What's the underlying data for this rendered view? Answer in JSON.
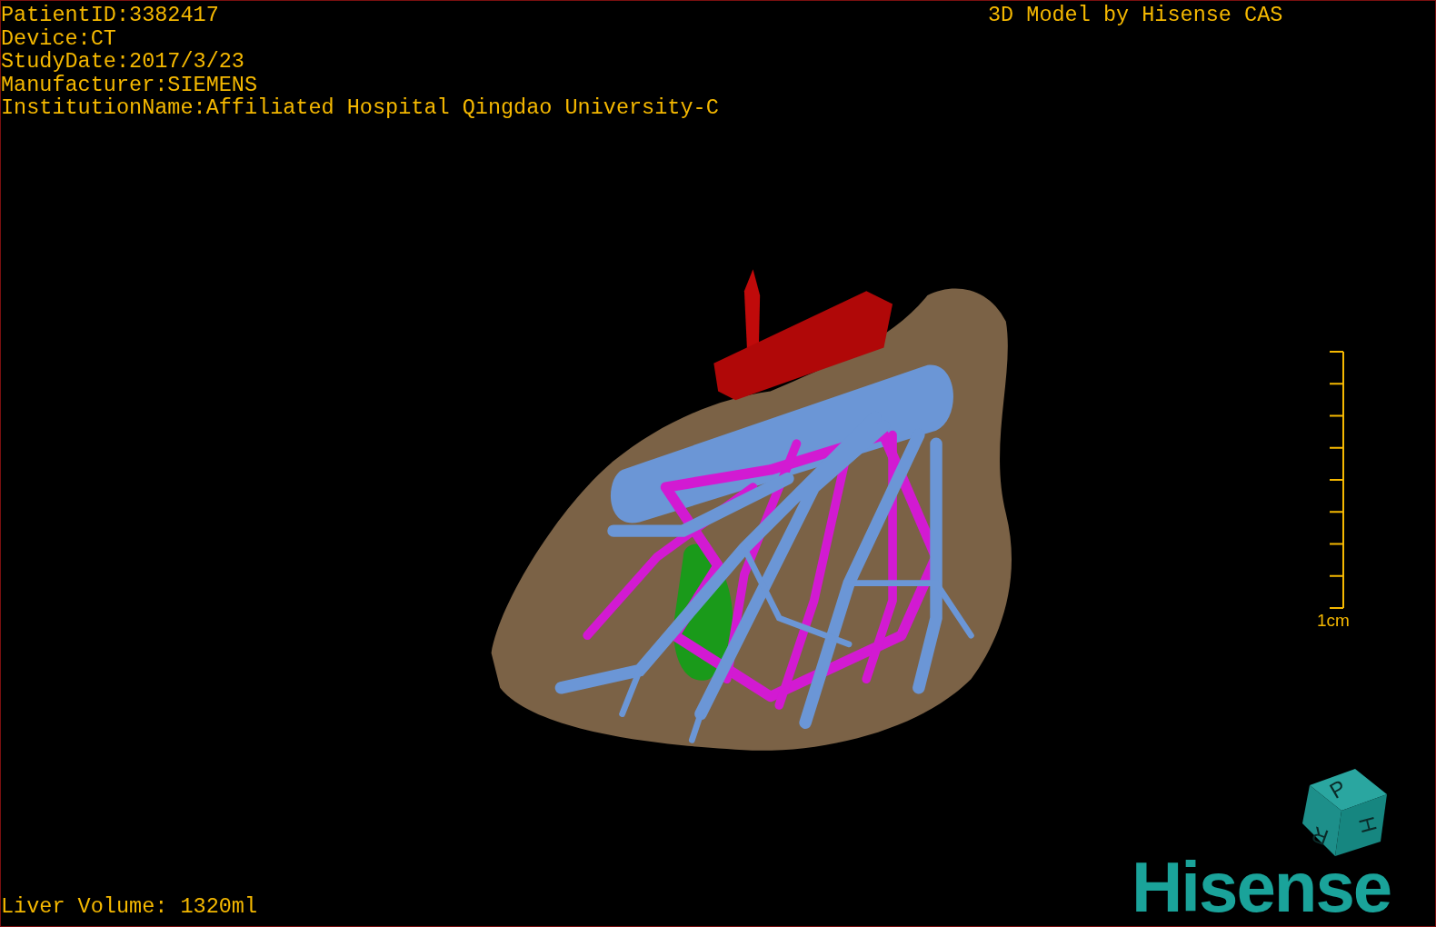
{
  "patient_info": [
    "PatientID:3382417",
    "Device:CT",
    "StudyDate:2017/3/23",
    "Manufacturer:SIEMENS",
    "InstitutionName:Affiliated Hospital Qingdao University-C"
  ],
  "model_credit": "3D Model by Hisense CAS",
  "scale_bar": {
    "label": "1cm"
  },
  "orientation_cube": {
    "labels": [
      "P",
      "H",
      "R"
    ]
  },
  "logo": "Hisense",
  "liver_volume": "Liver Volume: 1320ml"
}
